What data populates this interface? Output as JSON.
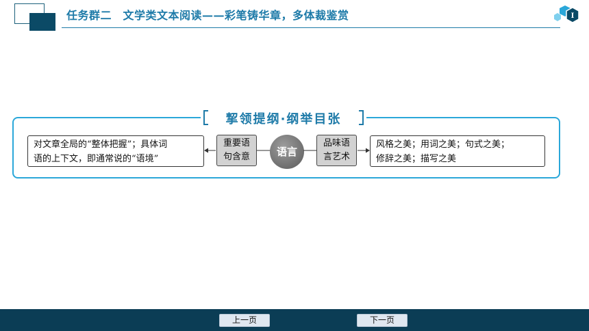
{
  "header": {
    "title": "任务群二　文学类文本阅读——彩笔铸华章，多体裁鉴赏",
    "badge": "I"
  },
  "section": {
    "title": "挈领提纲·纲举目张"
  },
  "diagram": {
    "center": "语言",
    "left_label": [
      "重要语",
      "句含意"
    ],
    "right_label": [
      "品味语",
      "言艺术"
    ],
    "left_text": [
      "对文章全局的“整体把握”；具体词",
      "语的上下文，即通常说的“语境”"
    ],
    "right_text": [
      "风格之美；用词之美；句式之美；",
      "修辞之美；描写之美"
    ]
  },
  "nav": {
    "prev": "上一页",
    "next": "下一页"
  },
  "colors": {
    "brand": "#1d7aa8",
    "frame": "#2aa7d9",
    "footer": "#0b3d55"
  }
}
